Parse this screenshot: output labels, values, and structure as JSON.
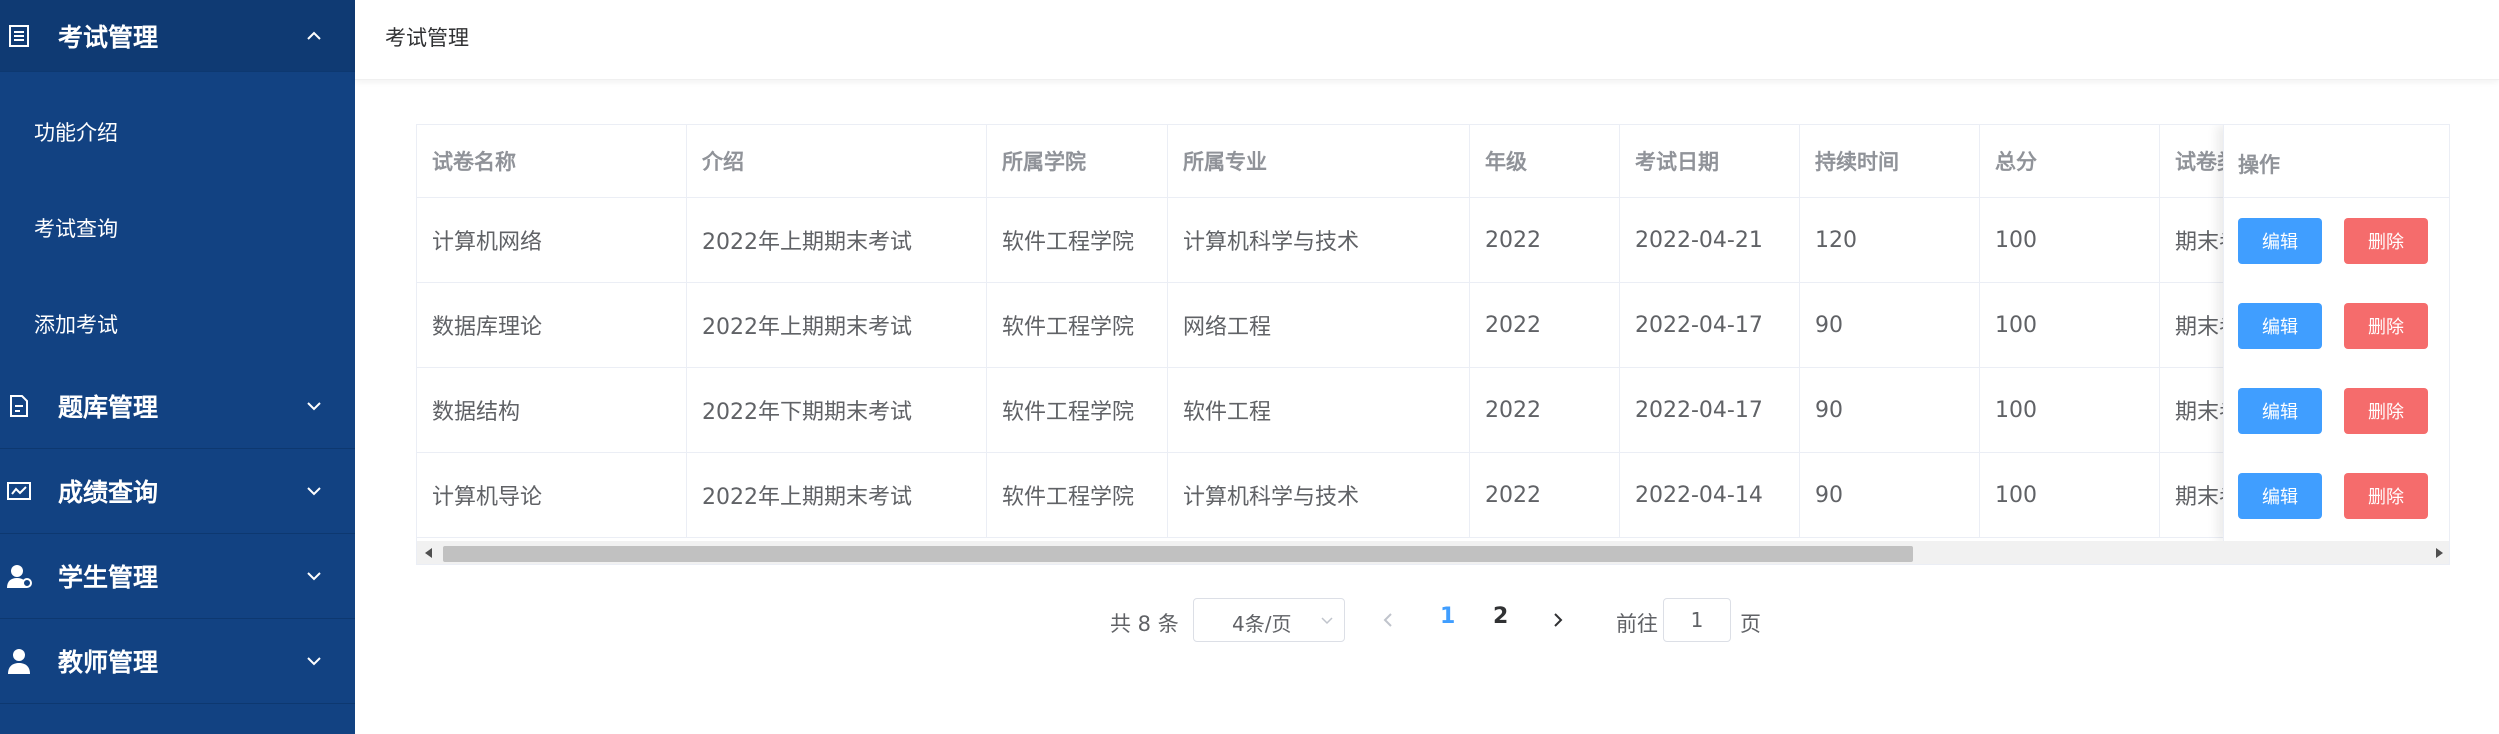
{
  "sidebar": {
    "menus": [
      {
        "title": "考试管理",
        "icon": "document-icon",
        "expanded": true
      },
      {
        "title": "题库管理",
        "icon": "edit-document-icon",
        "expanded": false
      },
      {
        "title": "成绩查询",
        "icon": "chart-card-icon",
        "expanded": false
      },
      {
        "title": "学生管理",
        "icon": "student-icon",
        "expanded": false
      },
      {
        "title": "教师管理",
        "icon": "user-icon",
        "expanded": false
      }
    ],
    "submenu": [
      "功能介绍",
      "考试查询",
      "添加考试"
    ]
  },
  "header": {
    "breadcrumb": "考试管理"
  },
  "table": {
    "columns": [
      "试卷名称",
      "介绍",
      "所属学院",
      "所属专业",
      "年级",
      "考试日期",
      "持续时间",
      "总分",
      "试卷类"
    ],
    "action_column": "操作",
    "edit_label": "编辑",
    "delete_label": "删除",
    "rows": [
      [
        "计算机网络",
        "2022年上期期末考试",
        "软件工程学院",
        "计算机科学与技术",
        "2022",
        "2022-04-21",
        "120",
        "100",
        "期末考"
      ],
      [
        "数据库理论",
        "2022年上期期末考试",
        "软件工程学院",
        "网络工程",
        "2022",
        "2022-04-17",
        "90",
        "100",
        "期末考"
      ],
      [
        "数据结构",
        "2022年下期期末考试",
        "软件工程学院",
        "软件工程",
        "2022",
        "2022-04-17",
        "90",
        "100",
        "期末考"
      ],
      [
        "计算机导论",
        "2022年上期期末考试",
        "软件工程学院",
        "计算机科学与技术",
        "2022",
        "2022-04-14",
        "90",
        "100",
        "期末考"
      ]
    ]
  },
  "pagination": {
    "total": "共 8 条",
    "page_size": "4条/页",
    "pages": [
      "1",
      "2"
    ],
    "current_page": "1",
    "goto_label": "前往",
    "goto_value": "1",
    "page_suffix": "页"
  },
  "colors": {
    "sidebar": "#124282",
    "primary": "#409eff",
    "danger": "#f56c6c",
    "text": "#606266",
    "header_text": "#909399"
  }
}
